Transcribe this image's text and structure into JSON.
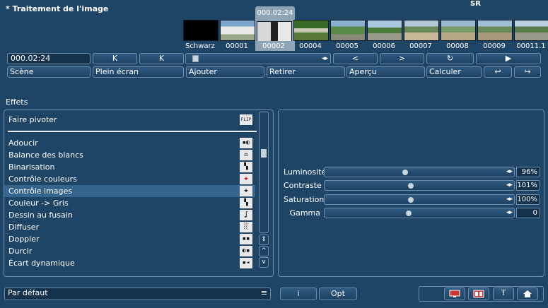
{
  "window": {
    "title": "* Traitement de l'image",
    "sr_label": "SR"
  },
  "timeline": {
    "current_timecode": "000.02:24",
    "frames": [
      {
        "label": "Schwarz",
        "selected": false
      },
      {
        "label": "00001",
        "selected": false
      },
      {
        "label": "00002",
        "selected": true
      },
      {
        "label": "00004",
        "selected": false
      },
      {
        "label": "00005",
        "selected": false
      },
      {
        "label": "00006",
        "selected": false
      },
      {
        "label": "00007",
        "selected": false
      },
      {
        "label": "00008",
        "selected": false
      },
      {
        "label": "00009",
        "selected": false
      },
      {
        "label": "00011.1",
        "selected": false
      }
    ]
  },
  "controls": {
    "timecode_field": "000.02:24",
    "prev_mark_icon": "K",
    "next_mark_icon": "K",
    "step_arrows": "◂▸",
    "prev_icon": "<",
    "next_icon": ">",
    "loop_icon": "↻",
    "play_icon": "▶"
  },
  "toolbar": {
    "scene": "Scène",
    "fullscreen": "Plein écran",
    "add": "Ajouter",
    "remove": "Retirer",
    "preview": "Aperçu",
    "calculate": "Calculer",
    "undo_icon": "↩",
    "redo_icon": "↪"
  },
  "effects": {
    "title": "Effets",
    "pinned": {
      "label": "Faire pivoter",
      "icon": "rotate-flip-icon",
      "glyph": "FLIP"
    },
    "items": [
      {
        "label": "Adoucir",
        "icon": "soften-icon",
        "glyph": "▪◐",
        "active": false
      },
      {
        "label": "Balance des blancs",
        "icon": "white-balance-icon",
        "glyph": "⚖",
        "active": false
      },
      {
        "label": "Binarisation",
        "icon": "binarization-icon",
        "glyph": "▚",
        "active": false
      },
      {
        "label": "Contrôle couleurs",
        "icon": "color-control-icon",
        "glyph": "✚",
        "active": false
      },
      {
        "label": "Contrôle images",
        "icon": "image-control-icon",
        "glyph": "✚",
        "active": true
      },
      {
        "label": "Couleur -> Gris",
        "icon": "color-to-gray-icon",
        "glyph": "▚",
        "active": false
      },
      {
        "label": "Dessin au fusain",
        "icon": "charcoal-icon",
        "glyph": "ʆ",
        "active": false
      },
      {
        "label": "Diffuser",
        "icon": "diffuse-icon",
        "glyph": "░",
        "active": false
      },
      {
        "label": "Doppler",
        "icon": "doppler-icon",
        "glyph": "▪▪",
        "active": false
      },
      {
        "label": "Durcir",
        "icon": "sharpen-icon",
        "glyph": "◐▪",
        "active": false
      },
      {
        "label": "Écart dynamique",
        "icon": "dynamic-range-icon",
        "glyph": "▪◂",
        "active": false
      }
    ]
  },
  "scroll": {
    "up_down": "⇕",
    "up": "^",
    "down": "v"
  },
  "adjustments": [
    {
      "label": "Luminosité",
      "value": "96%",
      "level": 0.46
    },
    {
      "label": "Contraste",
      "value": "101%",
      "level": 0.49
    },
    {
      "label": "Saturation",
      "value": "100%",
      "level": 0.49
    },
    {
      "label": "Gamma",
      "value": "0",
      "level": 0.48
    }
  ],
  "adjust_arrows": "◂▸",
  "bottom": {
    "preset": "Par défaut",
    "preset_menu_icon": "≡",
    "info": "i",
    "opt": "Opt",
    "monitor_icon": "monitor-icon",
    "film_icon": "film-icon",
    "text_icon": "T",
    "home_icon": "home-icon"
  },
  "colors": {
    "background": "#1f4566",
    "selected": "#8fa4b5",
    "border": "#6f8ea9"
  }
}
